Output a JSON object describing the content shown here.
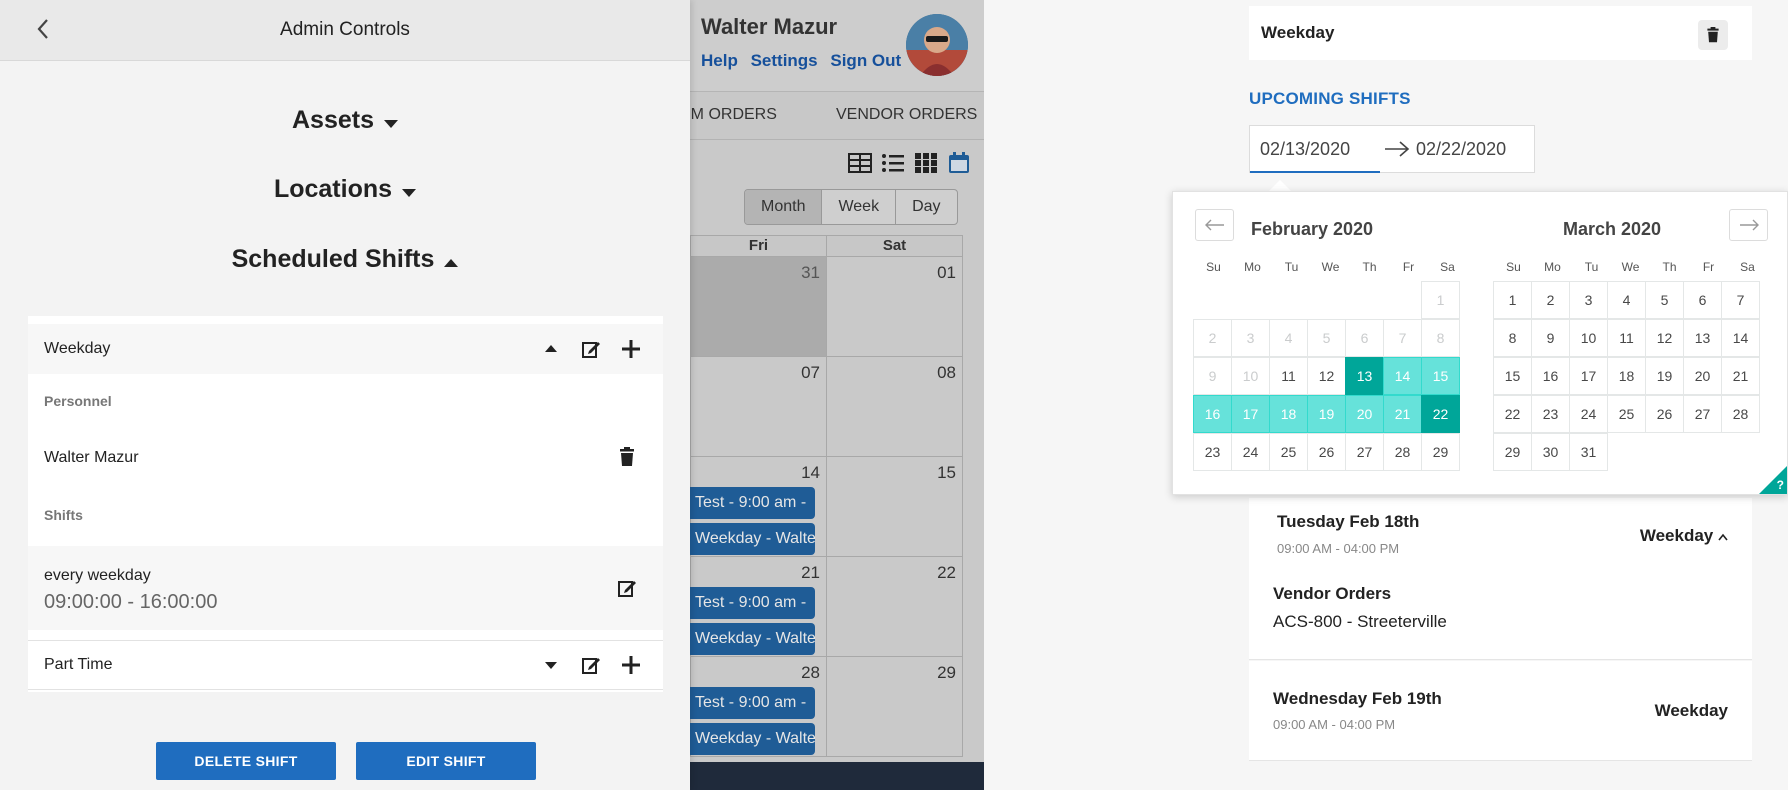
{
  "background_app": {
    "user_name": "Walter Mazur",
    "links": [
      "Help",
      "Settings",
      "Sign Out"
    ],
    "tabs": [
      "PM ORDERS",
      "VENDOR ORDERS"
    ],
    "view_buttons": [
      "Month",
      "Week",
      "Day"
    ],
    "day_headers": [
      "Fri",
      "Sat"
    ],
    "weeks": [
      {
        "fri": "31",
        "sat": "01"
      },
      {
        "fri": "07",
        "sat": "08"
      },
      {
        "fri": "14",
        "sat": "15"
      },
      {
        "fri": "21",
        "sat": "22"
      },
      {
        "fri": "28",
        "sat": "29"
      }
    ],
    "events": {
      "test": "Test - 9:00 am -",
      "weekday": "Weekday - Walter"
    }
  },
  "admin": {
    "title": "Admin Controls",
    "sections": {
      "assets": "Assets",
      "locations": "Locations",
      "scheduled_shifts": "Scheduled Shifts"
    },
    "shift": {
      "name": "Weekday",
      "personnel_label": "Personnel",
      "person": "Walter Mazur",
      "shifts_label": "Shifts",
      "recurrence": "every weekday",
      "time_range": "09:00:00 - 16:00:00",
      "next_shift": "Part Time"
    },
    "buttons": {
      "delete": "DELETE SHIFT",
      "edit": "EDIT SHIFT"
    }
  },
  "right_panel": {
    "top_title": "Weekday",
    "upcoming_label": "UPCOMING SHIFTS",
    "date_start": "02/13/2020",
    "date_end": "02/22/2020",
    "datepicker": {
      "weekdays": [
        "Su",
        "Mo",
        "Tu",
        "We",
        "Th",
        "Fr",
        "Sa"
      ],
      "months": [
        {
          "label": "February 2020",
          "weeks": [
            [
              "",
              "",
              "",
              "",
              "",
              "",
              "1"
            ],
            [
              "2",
              "3",
              "4",
              "5",
              "6",
              "7",
              "8"
            ],
            [
              "9",
              "10",
              "11",
              "12",
              "13",
              "14",
              "15"
            ],
            [
              "16",
              "17",
              "18",
              "19",
              "20",
              "21",
              "22"
            ],
            [
              "23",
              "24",
              "25",
              "26",
              "27",
              "28",
              "29"
            ]
          ],
          "disabled": [
            "1",
            "2",
            "3",
            "4",
            "5",
            "6",
            "7",
            "8",
            "9",
            "10"
          ],
          "selected": [
            "13",
            "22"
          ],
          "in_range": [
            "14",
            "15",
            "16",
            "17",
            "18",
            "19",
            "20",
            "21"
          ]
        },
        {
          "label": "March 2020",
          "weeks": [
            [
              "1",
              "2",
              "3",
              "4",
              "5",
              "6",
              "7"
            ],
            [
              "8",
              "9",
              "10",
              "11",
              "12",
              "13",
              "14"
            ],
            [
              "15",
              "16",
              "17",
              "18",
              "19",
              "20",
              "21"
            ],
            [
              "22",
              "23",
              "24",
              "25",
              "26",
              "27",
              "28"
            ],
            [
              "29",
              "30",
              "31",
              "",
              "",
              "",
              ""
            ]
          ],
          "disabled": [],
          "selected": [],
          "in_range": []
        }
      ],
      "help_glyph": "?"
    },
    "shifts_list": [
      {
        "day": "Tuesday Feb 18th",
        "time": "09:00 AM - 04:00 PM",
        "shift": "Weekday",
        "detail_label": "Vendor Orders",
        "detail_value": "ACS-800 - Streeterville"
      },
      {
        "day": "Wednesday Feb 19th",
        "time": "09:00 AM - 04:00 PM",
        "shift": "Weekday"
      }
    ]
  },
  "colors": {
    "primary_blue": "#1f6dbf",
    "teal_selected": "#00a699",
    "teal_range": "#66e2da"
  }
}
